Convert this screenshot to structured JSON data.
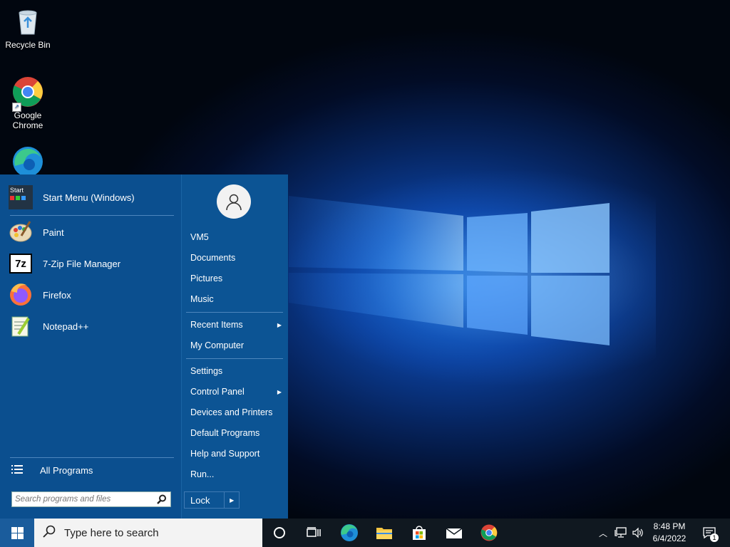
{
  "desktop": {
    "icons": [
      {
        "label": "Recycle Bin",
        "icon": "recycle-bin-icon"
      },
      {
        "label": "Google Chrome",
        "icon": "chrome-icon"
      },
      {
        "label": "",
        "icon": "edge-icon"
      }
    ]
  },
  "start_menu": {
    "pinned": [
      {
        "label": "Start Menu (Windows)",
        "icon": "start-menu-app-icon",
        "icon_text": "Start"
      },
      {
        "label": "Paint",
        "icon": "paint-icon"
      },
      {
        "label": "7-Zip File Manager",
        "icon": "7zip-icon",
        "icon_text": "7z"
      },
      {
        "label": "Firefox",
        "icon": "firefox-icon"
      },
      {
        "label": "Notepad++",
        "icon": "notepadpp-icon"
      }
    ],
    "all_programs": "All Programs",
    "search_placeholder": "Search programs and files",
    "right": {
      "user": "VM5",
      "documents": "Documents",
      "pictures": "Pictures",
      "music": "Music",
      "recent_items": "Recent Items",
      "my_computer": "My Computer",
      "settings": "Settings",
      "control_panel": "Control Panel",
      "devices_printers": "Devices and Printers",
      "default_programs": "Default Programs",
      "help_support": "Help and Support",
      "run": "Run..."
    },
    "lock": "Lock"
  },
  "taskbar": {
    "search_text": "Type here to search",
    "time": "8:48 PM",
    "date": "6/4/2022",
    "notification_count": "1"
  },
  "colors": {
    "menu_bg": "#0b4f8f",
    "taskbar_bg": "#101820",
    "accent": "#1a5c9c"
  }
}
